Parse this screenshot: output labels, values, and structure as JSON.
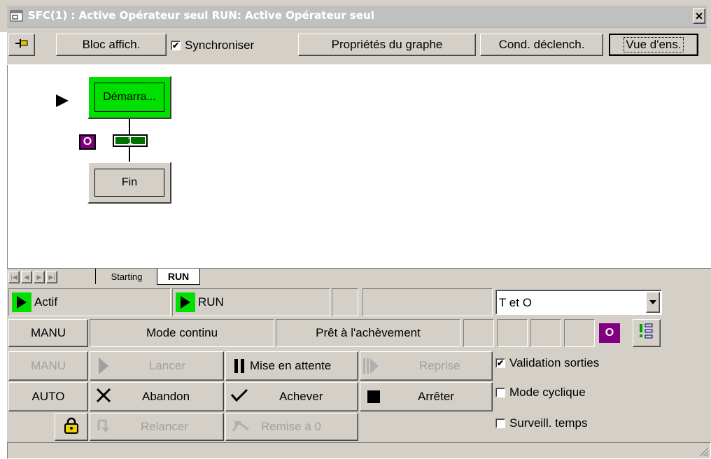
{
  "window": {
    "title": "SFC(1) : Active Opérateur seul RUN: Active Opérateur seul",
    "close_glyph": "×"
  },
  "toolbar": {
    "pin_icon": "pin-icon",
    "bloc_affich_label": "Bloc affich.",
    "synchroniser_label": "Synchroniser",
    "synchroniser_checked": true,
    "proprietes_label": "Propriétés du graphe",
    "cond_declench_label": "Cond. déclench.",
    "vue_ens_label": "Vue d'ens."
  },
  "graph": {
    "step1_label": "Démarra...",
    "step1_active_color": "#00e000",
    "transition_label": "1",
    "transition_color": "#007000",
    "o_badge": "O",
    "o_badge_color": "#800080",
    "step2_label": "Fin"
  },
  "tabs": {
    "items": [
      {
        "label": "Starting"
      },
      {
        "label": "RUN"
      }
    ],
    "active": "RUN"
  },
  "status": {
    "actif_label": "Actif",
    "run_label": "RUN",
    "filter_value": "T et O"
  },
  "row2": {
    "manu_label": "MANU",
    "mode_label": "Mode continu",
    "pret_label": "Prêt à l'achèvement",
    "o_badge": "O"
  },
  "controls": {
    "manu_label": "MANU",
    "lancer_label": "Lancer",
    "mise_en_attente_label": "Mise en attente",
    "reprise_label": "Reprise",
    "auto_label": "AUTO",
    "abandon_label": "Abandon",
    "achever_label": "Achever",
    "arreter_label": "Arrêter",
    "relancer_label": "Relancer",
    "remise_label": "Remise à 0"
  },
  "options": {
    "validation_label": "Validation sorties",
    "validation_checked": true,
    "cyclique_label": "Mode cyclique",
    "cyclique_checked": false,
    "surveill_label": "Surveill. temps",
    "surveill_checked": false
  }
}
